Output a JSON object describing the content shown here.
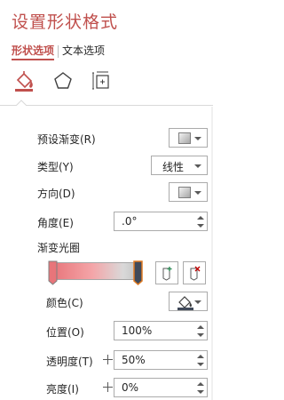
{
  "title": "设置形状格式",
  "tabs": [
    {
      "label": "形状选项",
      "active": true
    },
    {
      "label": "文本选项",
      "active": false
    }
  ],
  "icon_tabs": [
    "fill-line-icon",
    "effects-pentagon-icon",
    "size-properties-icon"
  ],
  "fields": {
    "preset": {
      "label": "预设渐变(R)"
    },
    "type": {
      "label": "类型(Y)",
      "value": "线性"
    },
    "direction": {
      "label": "方向(D)"
    },
    "angle": {
      "label": "角度(E)",
      "value": ".0°"
    },
    "gradient_stops_label": "渐变光圈",
    "color": {
      "label": "颜色(C)"
    },
    "position": {
      "label": "位置(O)",
      "value": "100%"
    },
    "transparency": {
      "label": "透明度(T)",
      "value": "50%"
    },
    "brightness": {
      "label": "亮度(I)",
      "value": "0%"
    }
  },
  "colors": {
    "accent": "#c0504d",
    "stop_left": "#e8757a",
    "stop_right": "#404a5a"
  }
}
